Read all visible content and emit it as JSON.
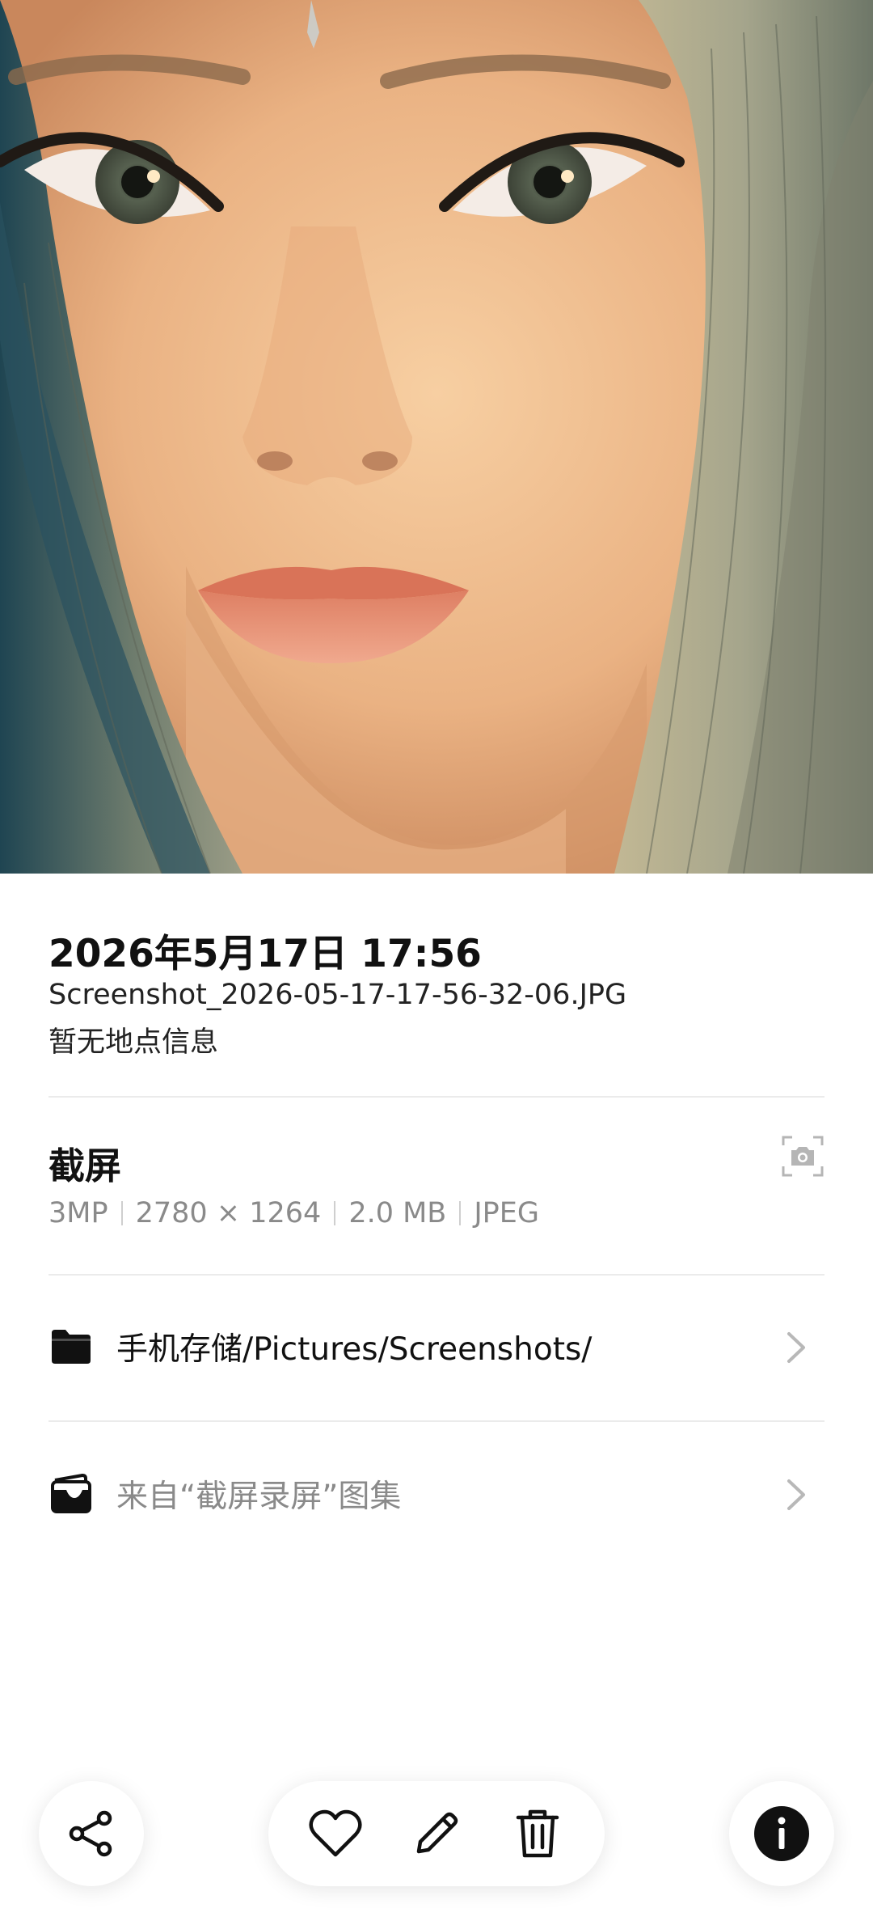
{
  "photo": {
    "subject": "close-up portrait of rendered female character face",
    "palette": {
      "skin": "#f0bf92",
      "skin_shadow": "#c9875c",
      "hair": "#8a8c78",
      "lips": "#e39075",
      "eye": "#4a5448",
      "background": "#274a58"
    }
  },
  "details": {
    "datetime": "2026年5月17日 17:56",
    "filename": "Screenshot_2026-05-17-17-56-32-06.JPG",
    "location": "暂无地点信息"
  },
  "type_section": {
    "title": "截屏",
    "specs": [
      "3MP",
      "2780 × 1264",
      "2.0 MB",
      "JPEG"
    ],
    "icon": "camera-icon"
  },
  "path_row": {
    "label": "手机存储/Pictures/Screenshots/",
    "icon": "folder-icon"
  },
  "album_row": {
    "label": "来自“截屏录屏”图集",
    "icon": "wallet-album-icon"
  },
  "toolbar": {
    "share": "share-icon",
    "favorite": "heart-icon",
    "edit": "pencil-icon",
    "delete": "trash-icon",
    "info": "info-icon",
    "accent": "#111111"
  }
}
